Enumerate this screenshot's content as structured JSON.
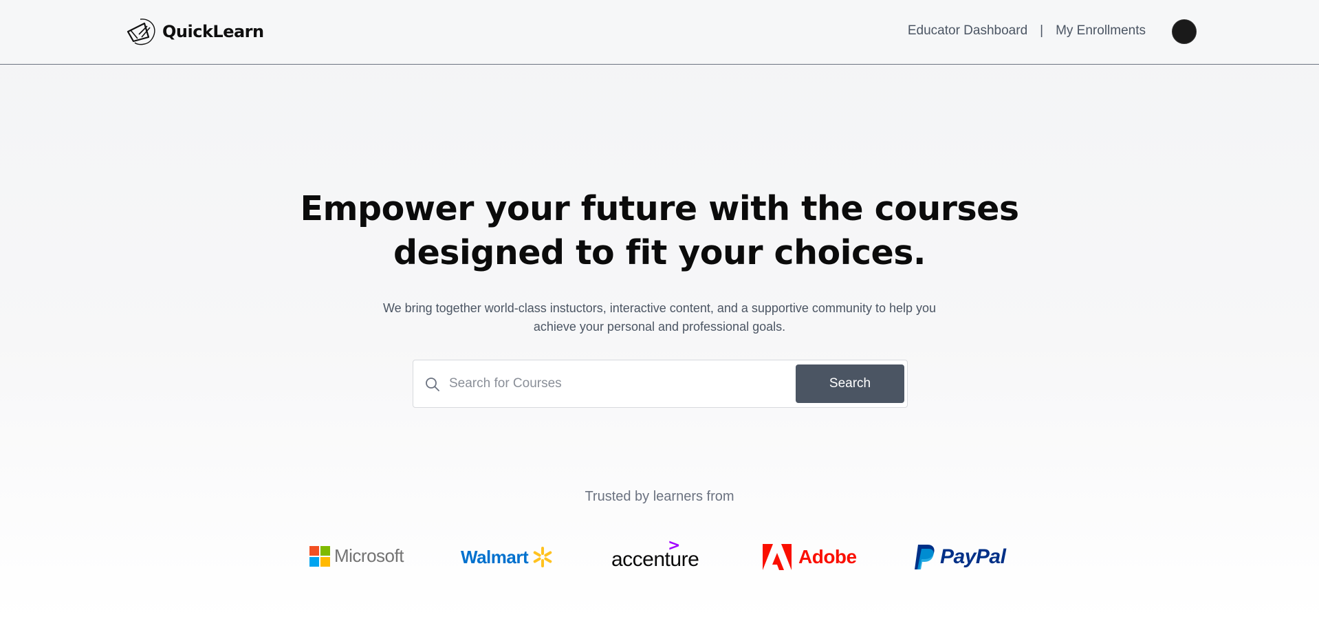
{
  "brand": {
    "name": "QuickLearn"
  },
  "nav": {
    "links": [
      "Educator Dashboard",
      "My Enrollments"
    ],
    "separator": "|"
  },
  "hero": {
    "title_line1": "Empower your future with the courses",
    "title_line2": "designed to fit your choices.",
    "subtitle_line1": "We bring together world-class instuctors, interactive content, and a supportive community to help you",
    "subtitle_line2": "achieve your personal and professional goals."
  },
  "search": {
    "placeholder": "Search for Courses",
    "value": "",
    "button_label": "Search"
  },
  "trusted": {
    "label": "Trusted by learners from",
    "companies": [
      "Microsoft",
      "Walmart",
      "accenture",
      "Adobe",
      "PayPal"
    ]
  },
  "colors": {
    "accent_button": "#4b5563",
    "microsoft": [
      "#f25022",
      "#7fba00",
      "#00a4ef",
      "#ffb900"
    ],
    "walmart_blue": "#0071ce",
    "walmart_yellow": "#ffc220",
    "accenture_purple": "#a100ff",
    "adobe_red": "#fa0f00",
    "paypal_dark": "#003087",
    "paypal_light": "#009cde"
  },
  "icons": [
    "logo-mark-icon",
    "search-icon",
    "microsoft-logo-icon",
    "walmart-spark-icon",
    "accenture-chevron-icon",
    "adobe-logo-icon",
    "paypal-logo-icon"
  ]
}
